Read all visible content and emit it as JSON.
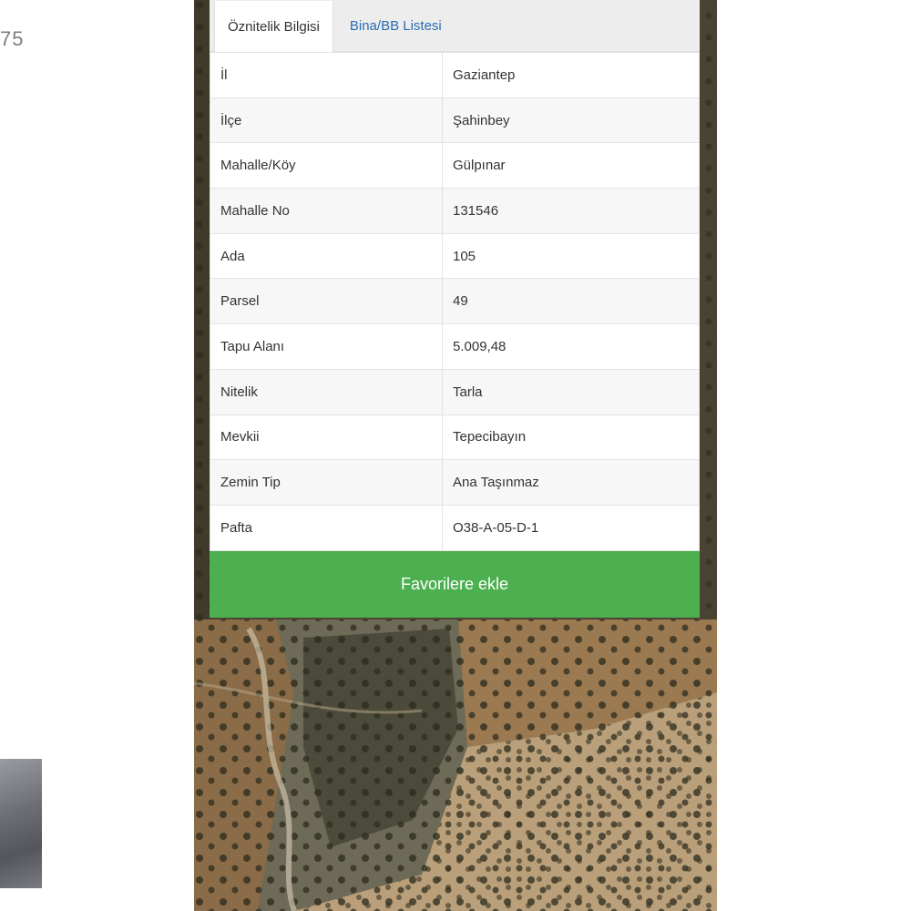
{
  "left_fragment_text": "75",
  "tabs": [
    {
      "label": "Öznitelik Bilgisi",
      "active": true
    },
    {
      "label": "Bina/BB Listesi",
      "active": false
    }
  ],
  "attributes": [
    {
      "key": "İl",
      "value": "Gaziantep"
    },
    {
      "key": "İlçe",
      "value": "Şahinbey"
    },
    {
      "key": "Mahalle/Köy",
      "value": "Gülpınar"
    },
    {
      "key": "Mahalle No",
      "value": "131546"
    },
    {
      "key": "Ada",
      "value": "105"
    },
    {
      "key": "Parsel",
      "value": "49"
    },
    {
      "key": "Tapu Alanı",
      "value": "5.009,48"
    },
    {
      "key": "Nitelik",
      "value": "Tarla"
    },
    {
      "key": "Mevkii",
      "value": "Tepecibayın"
    },
    {
      "key": "Zemin Tip",
      "value": "Ana Taşınmaz"
    },
    {
      "key": "Pafta",
      "value": "O38-A-05-D-1"
    }
  ],
  "favorite_button_label": "Favorilere ekle",
  "colors": {
    "button_green": "#4caf50",
    "tab_link_blue": "#2a6db3"
  }
}
